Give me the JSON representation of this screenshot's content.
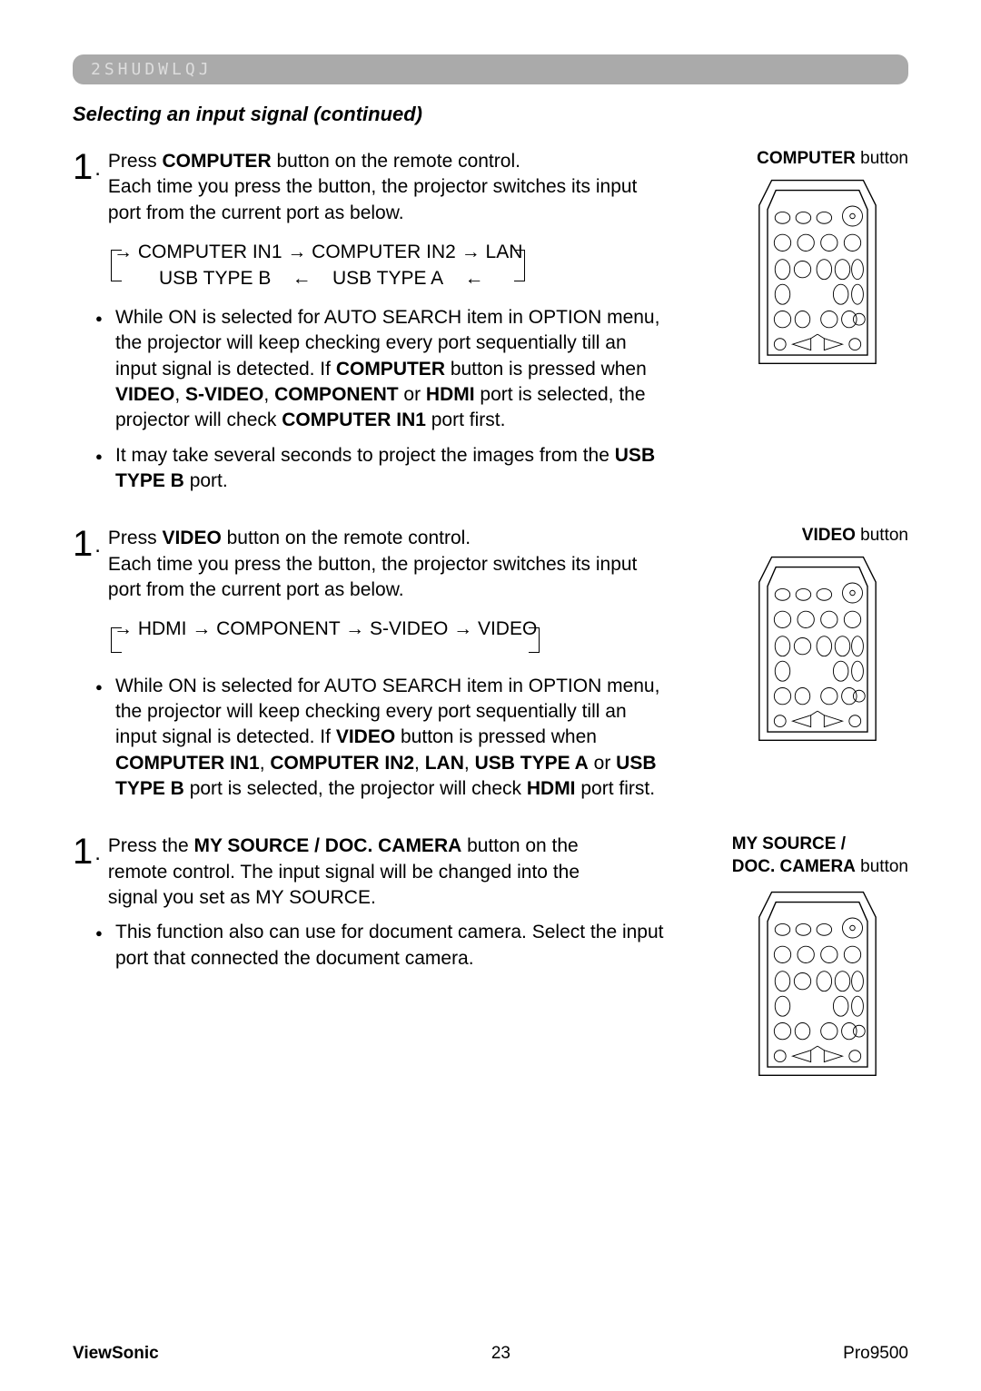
{
  "header_bar": "2SHUDWLQJ",
  "subtitle": "Selecting an input signal (continued)",
  "section1": {
    "num": "1",
    "dot": ".",
    "text_full": "Press <b>COMPUTER</b> button on the remote control.<br>Each time you press the button, the projector switches its input port from the current port as below.",
    "label": "COMPUTER",
    "label_suffix": " button",
    "cycle_line1": "→ COMPUTER IN1 → COMPUTER IN2 → LAN",
    "cycle_line2": "USB TYPE B&nbsp;&nbsp;&nbsp;&nbsp;←&nbsp;&nbsp;&nbsp;&nbsp;USB TYPE A&nbsp;&nbsp;&nbsp;&nbsp;←",
    "bullet1": "While ON is selected for AUTO SEARCH item in OPTION menu, the projector will keep checking every port sequentially till an input signal is detected. If <b>COMPUTER</b> button is pressed when <b>VIDEO</b>, <b>S-VIDEO</b>, <b>COMPONENT</b> or <b>HDMI</b> port is selected, the projector will check <b>COMPUTER IN1</b> port first.",
    "bullet2": "It may take several seconds to project the images from the <b>USB TYPE B</b> port."
  },
  "section2": {
    "num": "1",
    "dot": ".",
    "text_full": "Press <b>VIDEO</b> button on the remote control.<br>Each time you press the button, the projector switches its input port from the current port as below.",
    "label": "VIDEO",
    "label_suffix": " button",
    "cycle_line1": "→ HDMI → COMPONENT → S-VIDEO → VIDEO",
    "bullet1": "While ON is selected for AUTO SEARCH item in OPTION menu, the projector will keep checking every port sequentially till an input signal is detected. If <b>VIDEO</b> button is pressed when <b>COMPUTER IN1</b>, <b>COMPUTER IN2</b>, <b>LAN</b>, <b>USB TYPE A</b> or <b>USB TYPE B</b> port is selected, the projector will check <b>HDMI</b> port first."
  },
  "section3": {
    "num": "1",
    "dot": ".",
    "text_full": "Press the <b>MY SOURCE / DOC. CAMERA</b> button on the remote control. The input signal will be changed into the signal you set as MY SOURCE.",
    "label_line1": "MY SOURCE /",
    "label_line2": "DOC. CAMERA",
    "label_suffix": " button",
    "bullet1": "This function also can use for document camera. Select the input port that connected the document camera."
  },
  "footer": {
    "left": "ViewSonic",
    "center": "23",
    "right": "Pro9500"
  }
}
